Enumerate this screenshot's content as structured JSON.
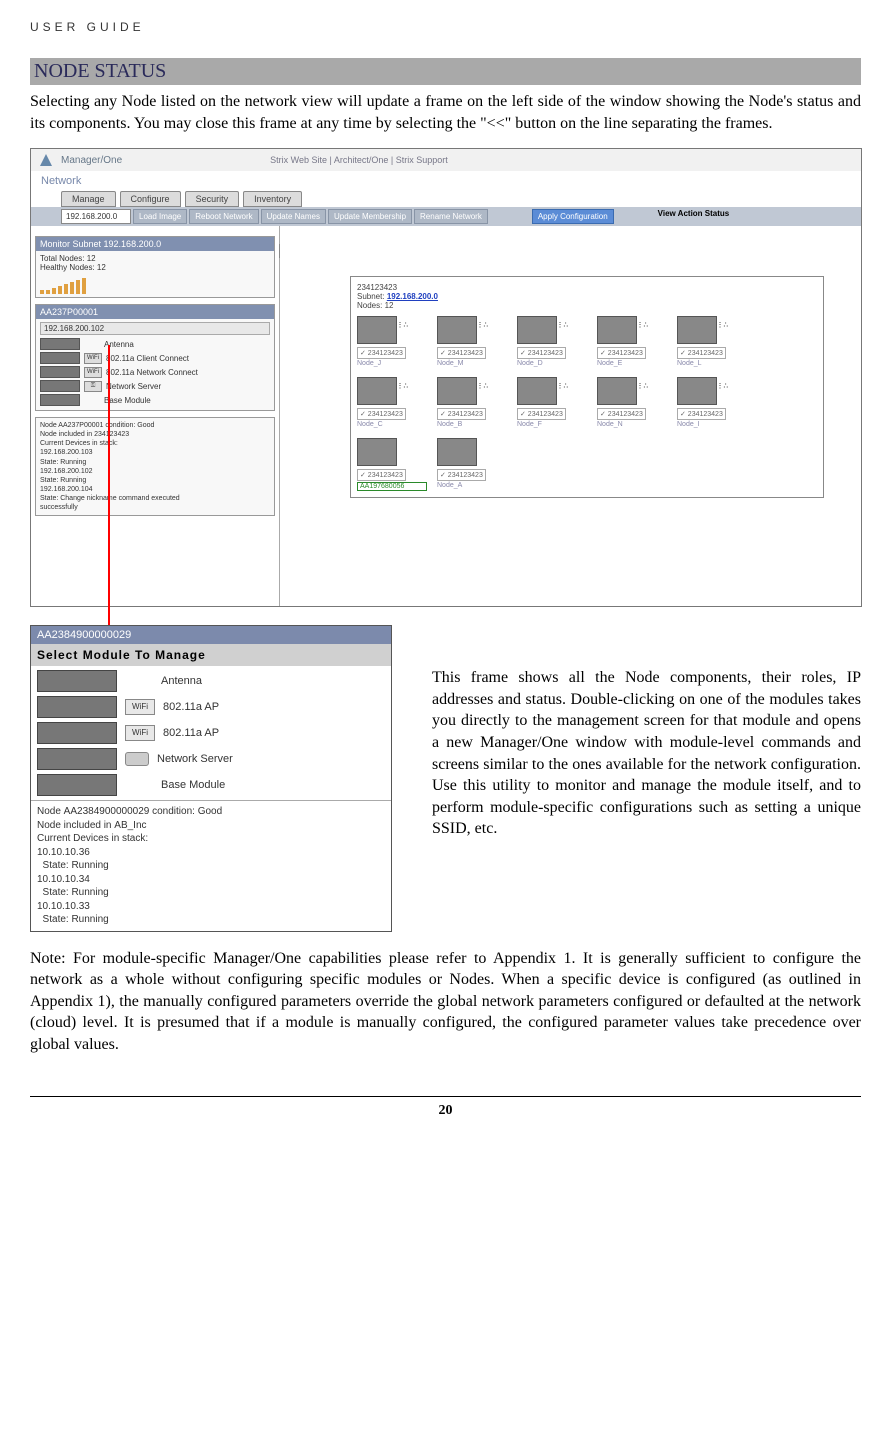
{
  "header": "USER GUIDE",
  "section_title": "NODE STATUS",
  "intro": "Selecting any Node listed on the network view will update a frame on the left side of the window showing the Node's status and its components. You may close this frame at any time by selecting the \"<<\" button on the line separating the frames.",
  "shot1": {
    "brand": "Manager/One",
    "toplinks": "Strix Web Site  |  Architect/One  |  Strix Support",
    "breadcrumb": "Network",
    "tabs": [
      "Manage",
      "Configure",
      "Security",
      "Inventory"
    ],
    "ip": "192.168.200.0",
    "toolbar": [
      "Load Image",
      "Reboot Network",
      "Update Names",
      "Update Membership",
      "Rename Network"
    ],
    "apply": "Apply Configuration",
    "view_action": "View Action Status",
    "divider": "<<",
    "monitor_title": "Monitor Subnet 192.168.200.0",
    "monitor_lines": [
      "Total Nodes: 12",
      "Healthy Nodes: 12"
    ],
    "node_panel_title": "AA237P00001",
    "node_ip": "192.168.200.102",
    "modules": [
      "Antenna",
      "802.11a Client Connect",
      "802.11a Network Connect",
      "Network Server",
      "Base Module"
    ],
    "status_lines": [
      "Node AA237P00001 condition: Good",
      "Node included in 234123423",
      "Current Devices in stack:",
      "192.168.200.103",
      "  State: Running",
      "192.168.200.102",
      "  State: Running",
      "192.168.200.104",
      "  State: Change nickname command executed",
      "successfully"
    ],
    "net_serial": "234123423",
    "net_subnet_lbl": "Subnet:",
    "net_subnet": "192.168.200.0",
    "net_nodes_lbl": "Nodes:",
    "net_nodes": "12",
    "grid_caption": "234123423",
    "grid_labels": [
      "Node_J",
      "Node_M",
      "Node_D",
      "Node_E",
      "Node_L",
      "Node_C",
      "Node_B",
      "Node_F",
      "Node_N",
      "Node_I"
    ],
    "grid_last_cap": "234123423",
    "grid_last_sel": "AA197680056",
    "grid_last_lbl": "Node_A"
  },
  "shot2": {
    "title": "AA2384900000029",
    "subtitle": "Select Module To Manage",
    "rows": [
      {
        "chip": "",
        "label": "Antenna"
      },
      {
        "chip": "WiFi",
        "label": "802.11a AP"
      },
      {
        "chip": "WiFi",
        "label": "802.11a AP"
      },
      {
        "chip": "key",
        "label": "Network Server"
      },
      {
        "chip": "",
        "label": "Base Module"
      }
    ],
    "status": [
      "Node AA2384900000029 condition: Good",
      "Node included in AB_Inc",
      "Current Devices in stack:",
      "10.10.10.36",
      "  State: Running",
      "10.10.10.34",
      "  State: Running",
      "10.10.10.33",
      "  State: Running"
    ]
  },
  "side_para": "This frame shows all the Node components, their roles, IP addresses and status. Double-clicking on one of the modules takes you directly to the management screen for that module and opens a new Manager/One window with module-level commands and screens similar to the ones available for the network configuration. Use this utility to monitor and manage the module itself, and to perform module-specific configurations such as setting a unique SSID, etc.",
  "note": "Note: For module-specific Manager/One capabilities please refer to Appendix 1. It is generally sufficient to configure the network as a whole without configuring specific modules or Nodes. When a specific device is configured (as outlined in Appendix 1), the manually configured parameters override the global network parameters configured or defaulted at the network (cloud) level. It is presumed that if a module is manually configured, the configured parameter values take precedence over global values.",
  "page_number": "20"
}
